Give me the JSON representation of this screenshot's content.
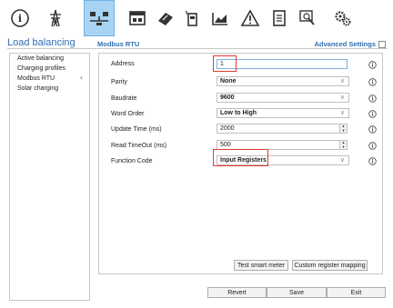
{
  "toolbar": {
    "icons": [
      "info-icon",
      "transmission-tower-icon",
      "load-balancing-icon",
      "charger-icon",
      "rfid-card-icon",
      "meter-icon",
      "chart-icon",
      "warning-icon",
      "document-icon",
      "search-icon",
      "settings-gears-icon"
    ],
    "active": "load-balancing-icon"
  },
  "header": {
    "section_title": "Load balancing",
    "subtitle": "Modbus RTU",
    "advanced_settings": "Advanced Settings",
    "advanced_checked": false
  },
  "sidebar": {
    "items": [
      {
        "label": "Active balancing"
      },
      {
        "label": "Charging profiles"
      },
      {
        "label": "Modbus RTU",
        "selected": true
      },
      {
        "label": "Solar charging"
      }
    ]
  },
  "form": {
    "address": {
      "label": "Address",
      "value": "1"
    },
    "parity": {
      "label": "Parity",
      "value": "None"
    },
    "baudrate": {
      "label": "Baudrate",
      "value": "9600"
    },
    "word_order": {
      "label": "Word Order",
      "value": "Low to High"
    },
    "update_time": {
      "label": "Update Time (ms)",
      "value": "2000"
    },
    "read_timeout": {
      "label": "Read TimeOut (ms)",
      "value": "500"
    },
    "function_code": {
      "label": "Function Code",
      "value": "Input Registers"
    }
  },
  "buttons": {
    "test_smart_meter": "Test smart meter",
    "custom_register_mapping": "Custom register mapping",
    "revert": "Revert",
    "save": "Save",
    "exit": "Exit"
  },
  "colors": {
    "accent": "#2f6fb0",
    "active_tab": "#a9d3f3",
    "highlight": "#e53935"
  }
}
